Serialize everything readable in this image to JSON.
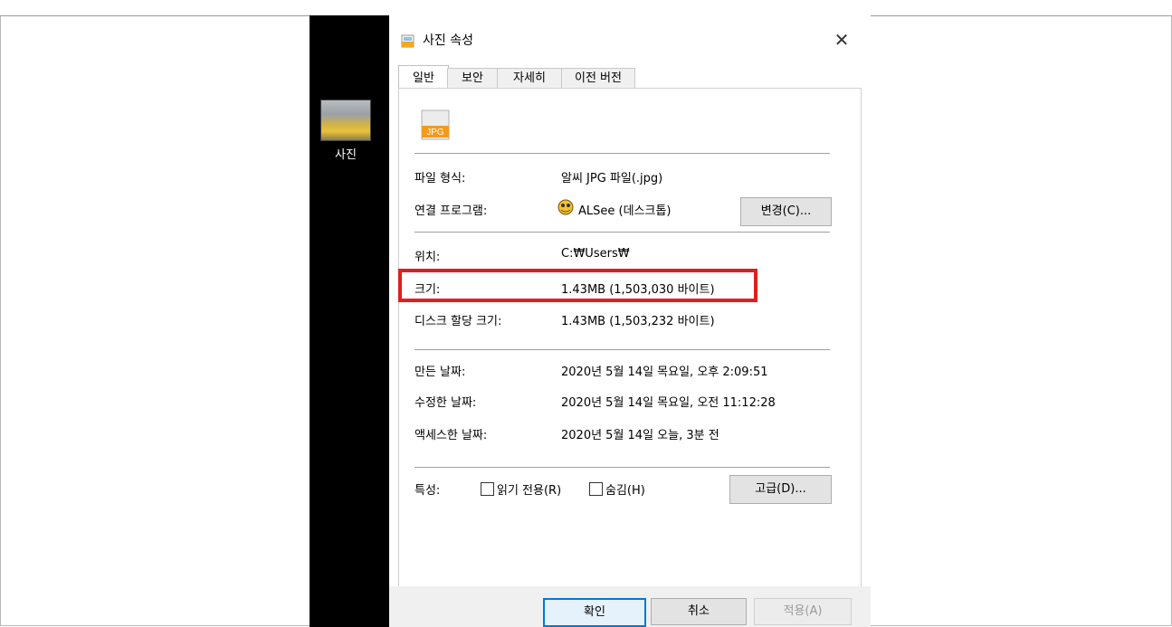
{
  "desktop": {
    "icon_label": "사진"
  },
  "dialog": {
    "title": "사진 속성",
    "close_glyph": "✕",
    "tabs": [
      "일반",
      "보안",
      "자세히",
      "이전 버전"
    ],
    "file_icon_text": "JPG",
    "fields": {
      "type_label": "파일 형식:",
      "type_value": "알씨 JPG 파일(.jpg)",
      "program_label": "연결 프로그램:",
      "program_value": "ALSee (데스크톱)",
      "change_button": "변경(C)...",
      "location_label": "위치:",
      "location_value": "C:₩Users₩",
      "size_label": "크기:",
      "size_value": "1.43MB (1,503,030 바이트)",
      "disk_size_label": "디스크 할당 크기:",
      "disk_size_value": "1.43MB (1,503,232 바이트)",
      "created_label": "만든 날짜:",
      "created_value": "2020년 5월 14일 목요일, 오후 2:09:51",
      "modified_label": "수정한 날짜:",
      "modified_value": "2020년 5월 14일 목요일, 오전 11:12:28",
      "accessed_label": "액세스한 날짜:",
      "accessed_value": "2020년 5월 14일 오늘, 3분 전",
      "attributes_label": "특성:",
      "readonly_label": "읽기 전용(R)",
      "hidden_label": "숨김(H)",
      "advanced_button": "고급(D)..."
    },
    "buttons": {
      "ok": "확인",
      "cancel": "취소",
      "apply": "적용(A)"
    }
  },
  "colors": {
    "highlight": "#e01e1e",
    "desktop": "#000000",
    "button_focus_border": "#0078d7"
  },
  "icons": {
    "title": "image-file-icon",
    "file": "jpg-file-icon",
    "program": "alsee-app-icon"
  }
}
